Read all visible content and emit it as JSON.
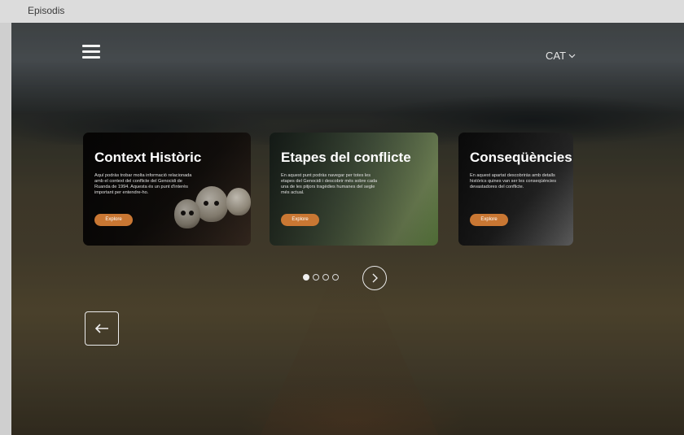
{
  "window": {
    "title": "Episodis"
  },
  "header": {
    "language": "CAT"
  },
  "cards": [
    {
      "title": "Context Històric",
      "text": "Aquí podràs trobar molta informació relacionada amb el context del conflicte del Genocidi de Ruanda de 1994. Aquesta és un punt d'interès important per entendre-ho.",
      "button": "Explore"
    },
    {
      "title": "Etapes del conflicte",
      "text": "En aquest punt podràs navegar per totes les etapes del Genocidi i descobrir més sobre cada una de les pitjors tragèdies humanes del segle més actual.",
      "button": "Explore"
    },
    {
      "title": "Conseqüències",
      "text": "En aquest apartat descobriràs amb detalls històrics quines van ser les conseqüències devastadores del conflicte.",
      "button": "Explore"
    }
  ],
  "pagination": {
    "total": 4,
    "active": 1
  },
  "icons": {
    "menu": "hamburger-menu-icon",
    "language_caret": "chevron-down-icon",
    "next": "chevron-right-icon",
    "back": "arrow-left-icon"
  },
  "colors": {
    "accent": "#c97733"
  }
}
